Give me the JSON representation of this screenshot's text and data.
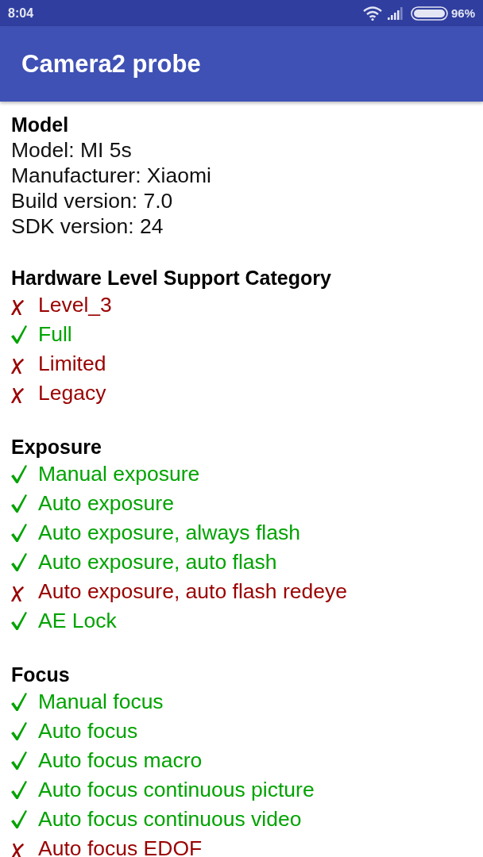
{
  "status_bar": {
    "time": "8:04",
    "battery": "96%"
  },
  "app_bar": {
    "title": "Camera2 probe"
  },
  "sections": [
    {
      "kind": "info",
      "title": "Model",
      "lines": [
        "Model: MI 5s",
        "Manufacturer: Xiaomi",
        "Build version: 7.0",
        "SDK version: 24"
      ]
    },
    {
      "kind": "checklist",
      "title": "Hardware Level Support Category",
      "items": [
        {
          "label": "Level_3",
          "supported": false
        },
        {
          "label": "Full",
          "supported": true
        },
        {
          "label": "Limited",
          "supported": false
        },
        {
          "label": "Legacy",
          "supported": false
        }
      ]
    },
    {
      "kind": "checklist",
      "title": "Exposure",
      "items": [
        {
          "label": "Manual exposure",
          "supported": true
        },
        {
          "label": "Auto exposure",
          "supported": true
        },
        {
          "label": "Auto exposure, always flash",
          "supported": true
        },
        {
          "label": "Auto exposure, auto flash",
          "supported": true
        },
        {
          "label": "Auto exposure, auto flash redeye",
          "supported": false
        },
        {
          "label": "AE Lock",
          "supported": true
        }
      ]
    },
    {
      "kind": "checklist",
      "title": "Focus",
      "items": [
        {
          "label": "Manual focus",
          "supported": true
        },
        {
          "label": "Auto focus",
          "supported": true
        },
        {
          "label": "Auto focus macro",
          "supported": true
        },
        {
          "label": "Auto focus continuous picture",
          "supported": true
        },
        {
          "label": "Auto focus continuous video",
          "supported": true
        },
        {
          "label": "Auto focus EDOF",
          "supported": false
        }
      ]
    }
  ]
}
